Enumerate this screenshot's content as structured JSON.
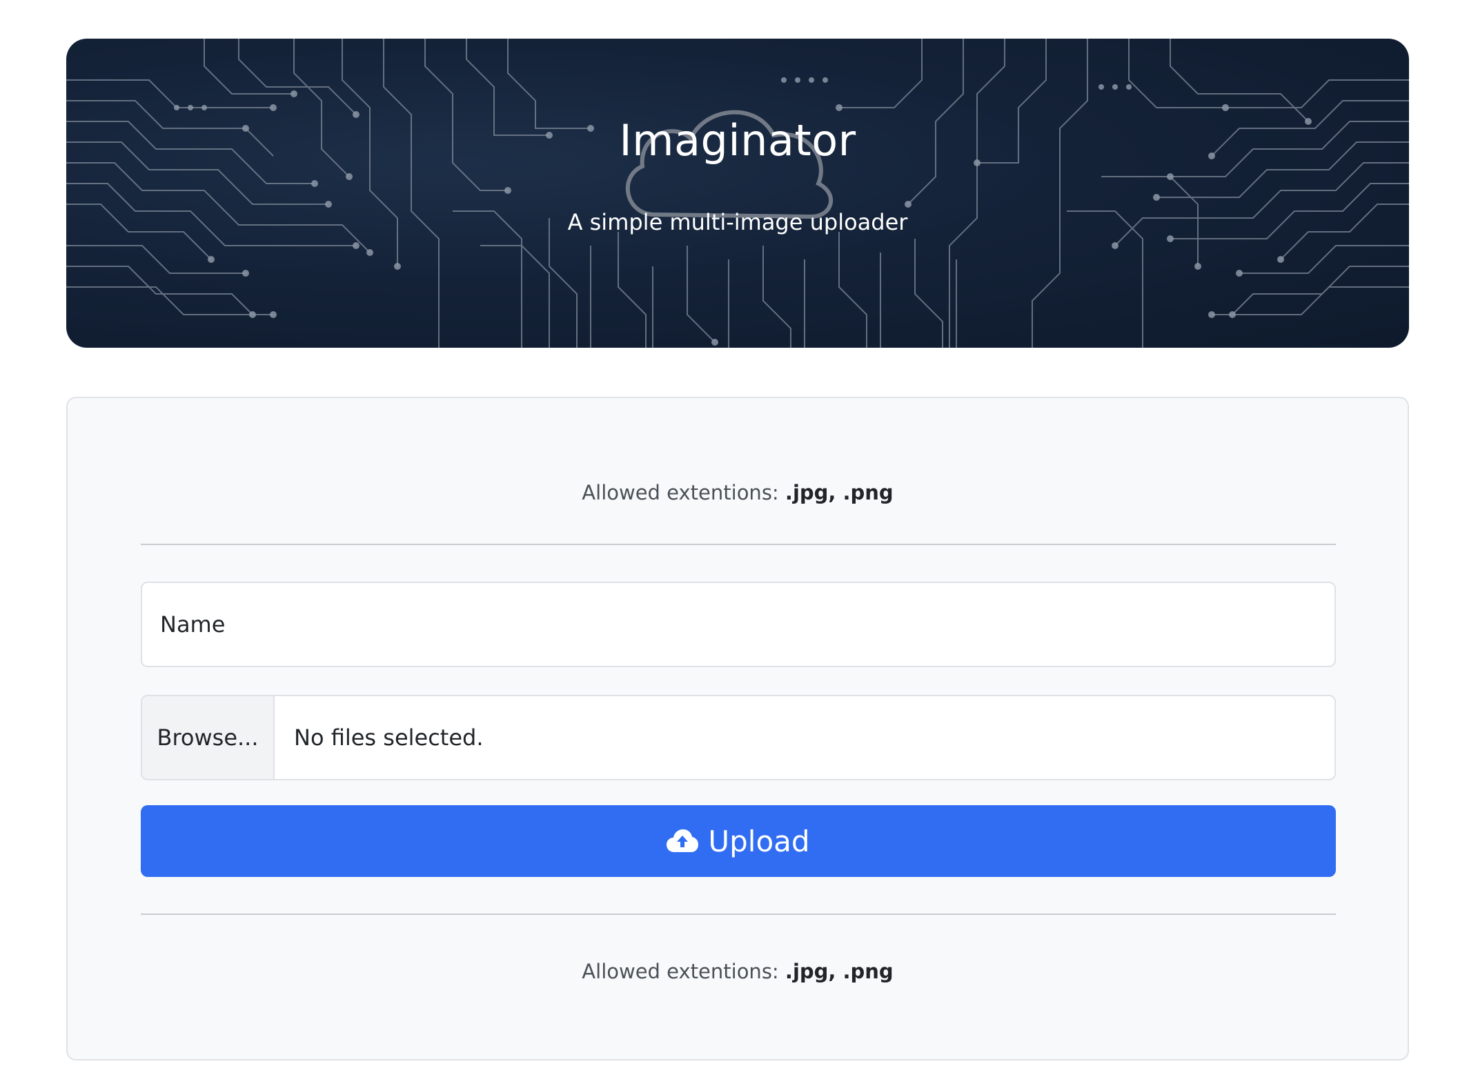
{
  "header": {
    "title": "Imaginator",
    "subtitle": "A simple multi-image uploader"
  },
  "form": {
    "note_prefix": "Allowed extentions: ",
    "note_extensions": ".jpg, .png",
    "name_placeholder": "Name",
    "browse_label": "Browse...",
    "file_status": "No files selected.",
    "upload_label": "Upload",
    "upload_icon": "cloud-upload-icon"
  },
  "colors": {
    "primary": "#316df2",
    "hero_background": "#142238",
    "card_background": "#f8f9fa"
  }
}
